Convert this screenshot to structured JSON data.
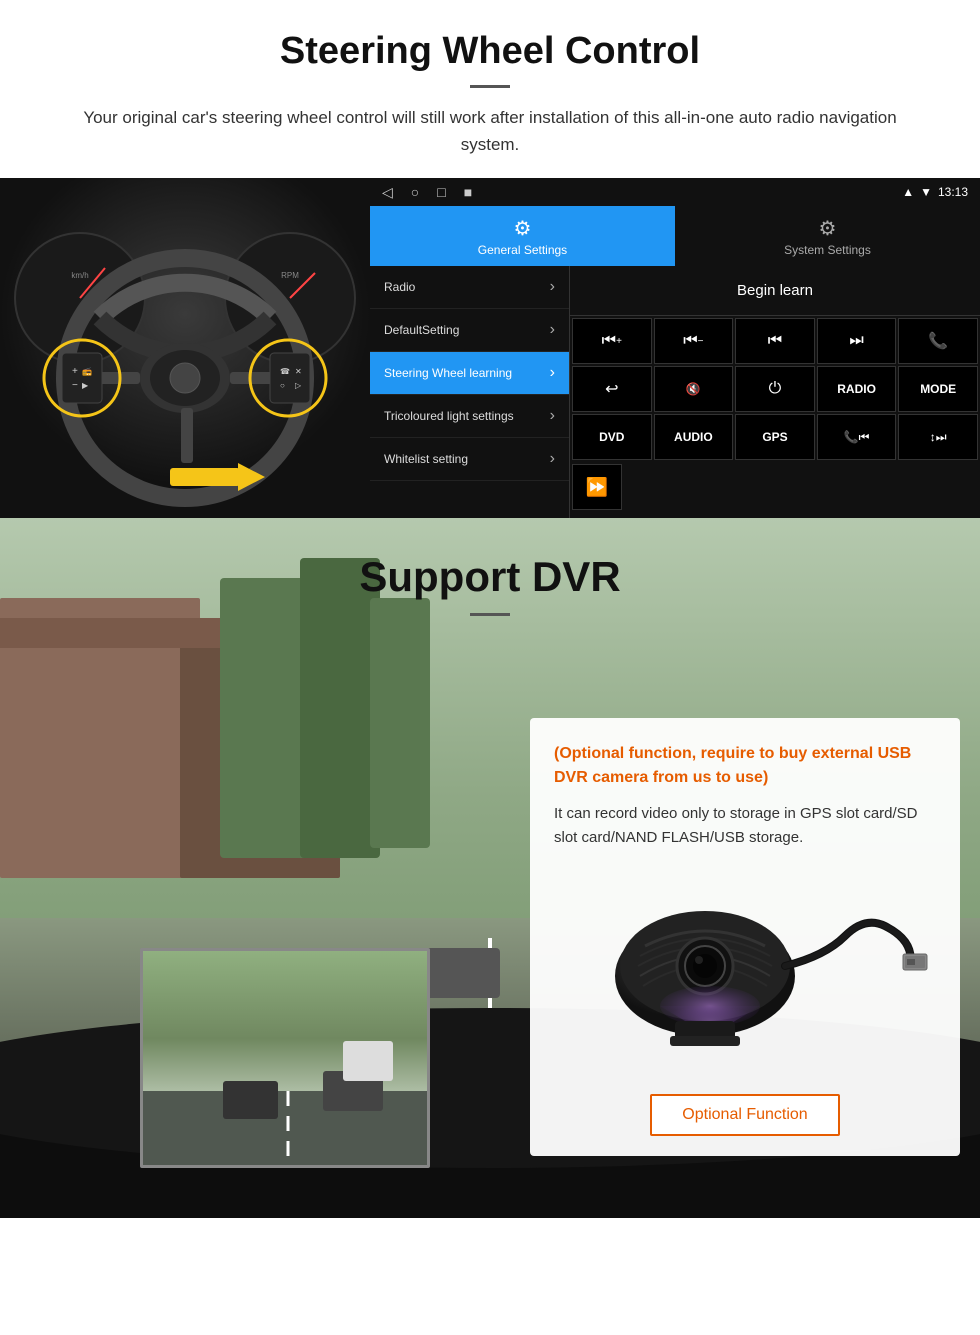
{
  "header": {
    "title": "Steering Wheel Control",
    "divider": true,
    "subtitle": "Your original car's steering wheel control will still work after installation of this all-in-one auto radio navigation system."
  },
  "android_ui": {
    "status_bar": {
      "time": "13:13",
      "nav_icons": [
        "◁",
        "○",
        "□",
        "■"
      ]
    },
    "tabs": [
      {
        "id": "general",
        "label": "General Settings",
        "icon": "⚙",
        "active": true
      },
      {
        "id": "system",
        "label": "System Settings",
        "icon": "🔧",
        "active": false
      }
    ],
    "menu_items": [
      {
        "label": "Radio",
        "active": false
      },
      {
        "label": "DefaultSetting",
        "active": false
      },
      {
        "label": "Steering Wheel learning",
        "active": true
      },
      {
        "label": "Tricoloured light settings",
        "active": false
      },
      {
        "label": "Whitelist setting",
        "active": false
      }
    ],
    "begin_learn_label": "Begin learn",
    "control_buttons": [
      {
        "symbol": "⏮+",
        "row": 1
      },
      {
        "symbol": "⏮−",
        "row": 1
      },
      {
        "symbol": "⏮",
        "row": 1
      },
      {
        "symbol": "⏭",
        "row": 1
      },
      {
        "symbol": "📞",
        "row": 1
      },
      {
        "symbol": "↩",
        "row": 2
      },
      {
        "symbol": "🔇",
        "row": 2
      },
      {
        "symbol": "⏻",
        "row": 2
      },
      {
        "symbol": "RADIO",
        "row": 2
      },
      {
        "symbol": "MODE",
        "row": 2
      },
      {
        "symbol": "DVD",
        "row": 3
      },
      {
        "symbol": "AUDIO",
        "row": 3
      },
      {
        "symbol": "GPS",
        "row": 3
      },
      {
        "symbol": "📞⏮",
        "row": 3
      },
      {
        "symbol": "↕⏭",
        "row": 3
      }
    ],
    "bottom_special": "⏩"
  },
  "dvr_section": {
    "title": "Support DVR",
    "info_card": {
      "orange_text": "(Optional function, require to buy external USB DVR camera from us to use)",
      "body_text": "It can record video only to storage in GPS slot card/SD slot card/NAND FLASH/USB storage.",
      "optional_button_label": "Optional Function"
    }
  }
}
